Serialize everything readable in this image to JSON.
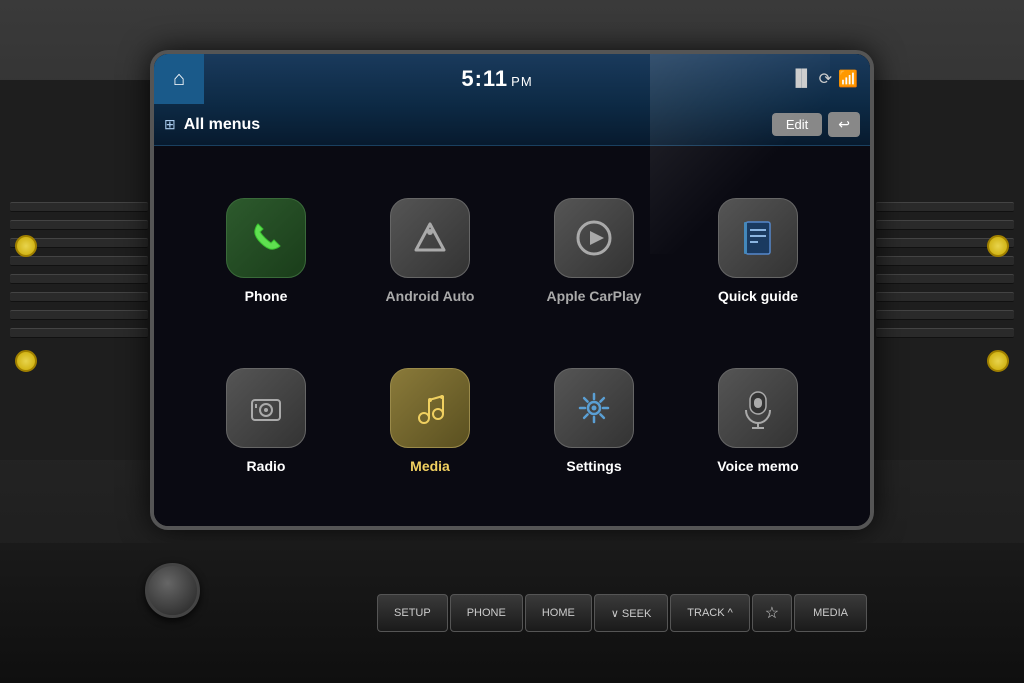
{
  "screen": {
    "time": "5:11",
    "ampm": "PM",
    "header": {
      "home_label": "Home"
    },
    "menu_bar": {
      "title": "All menus",
      "edit_label": "Edit",
      "back_label": "↩"
    },
    "apps": [
      {
        "id": "phone",
        "label": "Phone",
        "icon_type": "phone",
        "icon_color": "dark-green",
        "label_color": "white"
      },
      {
        "id": "android-auto",
        "label": "Android Auto",
        "icon_type": "android-auto",
        "icon_color": "dark-gray",
        "label_color": "gray"
      },
      {
        "id": "apple-carplay",
        "label": "Apple CarPlay",
        "icon_type": "carplay",
        "icon_color": "dark-gray",
        "label_color": "gray"
      },
      {
        "id": "quick-guide",
        "label": "Quick guide",
        "icon_type": "quickguide",
        "icon_color": "dark-gray",
        "label_color": "white"
      },
      {
        "id": "radio",
        "label": "Radio",
        "icon_type": "radio",
        "icon_color": "dark-gray",
        "label_color": "white"
      },
      {
        "id": "media",
        "label": "Media",
        "icon_type": "media",
        "icon_color": "gold",
        "label_color": "golden"
      },
      {
        "id": "settings",
        "label": "Settings",
        "icon_type": "settings",
        "icon_color": "dark-gray",
        "label_color": "white"
      },
      {
        "id": "voice-memo",
        "label": "Voice memo",
        "icon_type": "voicememo",
        "icon_color": "dark-gray",
        "label_color": "white"
      }
    ]
  },
  "controls": {
    "buttons": [
      {
        "id": "setup",
        "label": "SETUP"
      },
      {
        "id": "phone-btn",
        "label": "PHONE"
      },
      {
        "id": "home-btn",
        "label": "HOME"
      },
      {
        "id": "seek",
        "label": "∨ SEEK"
      },
      {
        "id": "track",
        "label": "TRACK ^"
      },
      {
        "id": "media-btn",
        "label": "MEDIA"
      }
    ]
  },
  "colors": {
    "header_bg": "#0d2a45",
    "screen_bg": "#0a0a12",
    "accent_blue": "#1a5a8a",
    "yellow_vent": "#e8d44d"
  }
}
